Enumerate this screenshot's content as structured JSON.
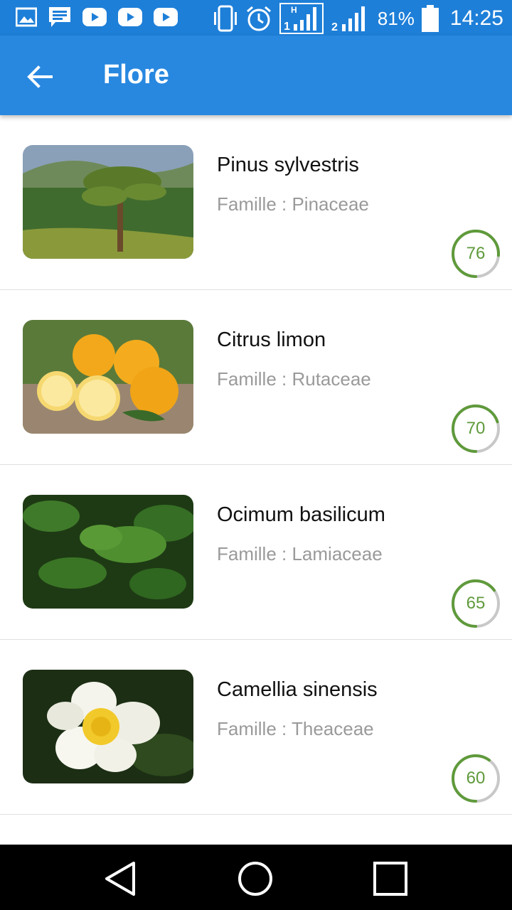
{
  "status_bar": {
    "battery": "81%",
    "time": "14:25",
    "icons": [
      "image-icon",
      "message-icon",
      "youtube-icon",
      "youtube-icon",
      "youtube-icon",
      "vibrate-icon",
      "alarm-icon",
      "signal-h-1-icon",
      "signal-2-icon",
      "battery-icon"
    ]
  },
  "app_bar": {
    "title": "Flore",
    "back_icon": "arrow-back-icon"
  },
  "items": [
    {
      "name": "Pinus sylvestris",
      "family_prefix": "Famille : ",
      "family": "Pinaceae",
      "score": "76",
      "score_fraction": 0.76
    },
    {
      "name": "Citrus limon",
      "family_prefix": "Famille : ",
      "family": "Rutaceae",
      "score": "70",
      "score_fraction": 0.7
    },
    {
      "name": "Ocimum basilicum",
      "family_prefix": "Famille : ",
      "family": "Lamiaceae",
      "score": "65",
      "score_fraction": 0.65
    },
    {
      "name": "Camellia sinensis",
      "family_prefix": "Famille : ",
      "family": "Theaceae",
      "score": "60",
      "score_fraction": 0.6
    }
  ],
  "colors": {
    "primary": "#2888e0",
    "status": "#1e7fd8",
    "score_green": "#5f9a3b",
    "score_track": "#c8c8c8"
  },
  "nav_bar": {
    "icons": [
      "back-triangle-icon",
      "home-circle-icon",
      "recents-square-icon"
    ]
  }
}
